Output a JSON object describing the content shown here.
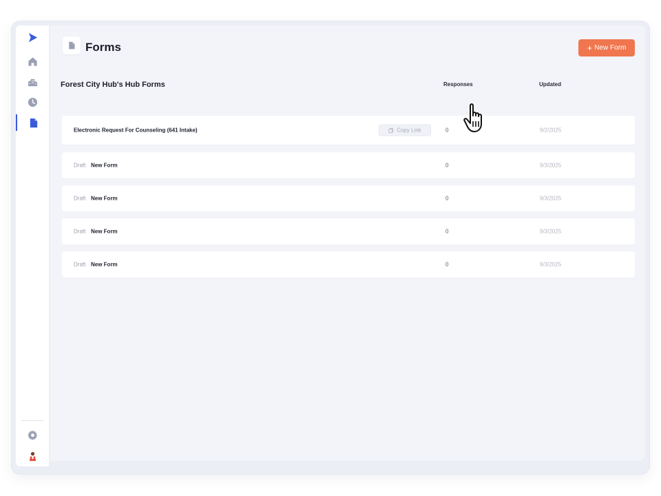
{
  "header": {
    "title": "Forms",
    "new_form_label": "New Form",
    "new_form_plus": "+"
  },
  "section": {
    "title": "Forest City Hub's Hub Forms"
  },
  "columns": {
    "responses": "Responses",
    "updated": "Updated"
  },
  "rows": [
    {
      "status": "",
      "name": "Electronic Request For Counseling (641 Intake)",
      "copy_link": "Copy Link",
      "responses": "0",
      "updated": "9/2/2025"
    },
    {
      "status": "Draft",
      "name": "New Form",
      "responses": "0",
      "updated": "9/3/2025"
    },
    {
      "status": "Draft",
      "name": "New Form",
      "responses": "0",
      "updated": "9/3/2025"
    },
    {
      "status": "Draft",
      "name": "New Form",
      "responses": "0",
      "updated": "9/3/2025"
    },
    {
      "status": "Draft",
      "name": "New Form",
      "responses": "0",
      "updated": "9/3/2025"
    }
  ],
  "sidebar": {
    "items": [
      {
        "icon": "logo-play-icon"
      },
      {
        "icon": "home-icon"
      },
      {
        "icon": "buildings-icon"
      },
      {
        "icon": "clock-icon"
      },
      {
        "icon": "document-icon",
        "active": true
      },
      {
        "icon": "gear-icon"
      },
      {
        "icon": "avatar-icon"
      }
    ]
  },
  "colors": {
    "accent": "#f0764f",
    "brand": "#3b5bdb",
    "icon_muted": "#9aa0b4"
  }
}
